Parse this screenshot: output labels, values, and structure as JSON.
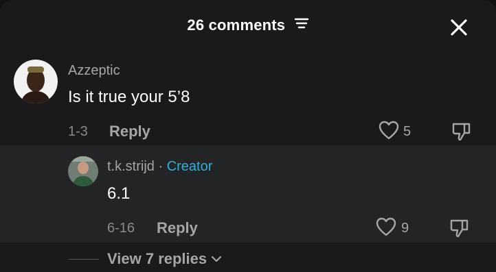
{
  "header": {
    "title": "26 comments",
    "filter_icon": "filter-lines-icon",
    "close_icon": "close-icon"
  },
  "comment": {
    "username": "Azzeptic",
    "text": "Is it true your 5’8",
    "date": "1-3",
    "reply_label": "Reply",
    "likes": "5"
  },
  "reply": {
    "username": "t.k.strijd",
    "separator": "·",
    "creator_label": "Creator",
    "text": "6.1",
    "date": "6-16",
    "reply_label": "Reply",
    "likes": "9"
  },
  "view_replies": {
    "label": "View 7 replies"
  },
  "colors": {
    "background": "#1a1a1a",
    "reply_background": "#222426",
    "creator_accent": "#2fb0d8",
    "secondary_text": "#a6a6a6"
  }
}
